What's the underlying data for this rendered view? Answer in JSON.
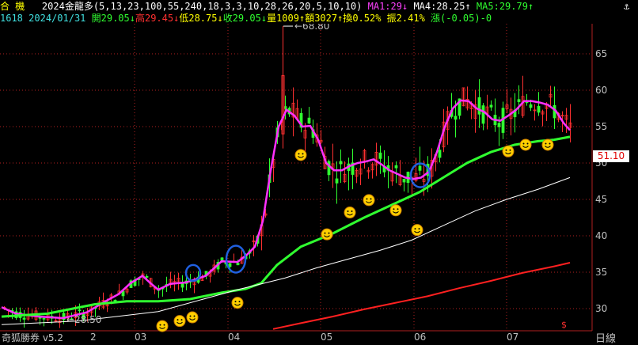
{
  "header": {
    "left1": "合  機",
    "indicator": "2024金龍多(5,13,23,100,55,240,18,3,3,10,28,26,20,5,10,10)",
    "ma1": "MA1:29↓",
    "ma4": "MA4:28.25↑",
    "ma5": "MA5:29.79↑",
    "code": "1618",
    "date": "2024/01/31",
    "open": "開29.05↓",
    "high": "高29.45↓",
    "low": "低28.75↓",
    "close": "收29.05↓",
    "volume": "量1009↑",
    "amount": "額3027↑",
    "turnover": "換0.52%",
    "amplitude": "振2.41%",
    "change": "漲(-0.05)-0"
  },
  "chart_data": {
    "type": "line",
    "y_ticks": [
      30,
      35,
      40,
      45,
      50,
      55,
      60,
      65
    ],
    "x_labels": [
      "03",
      "04",
      "05",
      "06",
      "07"
    ],
    "x_label_partial": "2",
    "last_price": "51.10",
    "max_label": "68.80",
    "min_label": "28.50",
    "period_label": "日線",
    "footer": "奇狐勝券 v5.2",
    "colors": {
      "ma_short": "#ff30ff",
      "ma_mid": "#30ff30",
      "ma_long": "#ffffff",
      "ma_longest": "#ff2020",
      "up": "#ff3030",
      "down": "#30ff30",
      "circle": "#2060e0"
    },
    "series": [
      {
        "key": "ma_short",
        "points": [
          [
            2,
            30.2
          ],
          [
            20,
            29.3
          ],
          [
            50,
            28.9
          ],
          [
            80,
            28.7
          ],
          [
            110,
            29.5
          ],
          [
            130,
            30.8
          ],
          [
            150,
            32
          ],
          [
            165,
            33.5
          ],
          [
            180,
            34.5
          ],
          [
            190,
            33.5
          ],
          [
            200,
            32.6
          ],
          [
            215,
            33.4
          ],
          [
            235,
            33.6
          ],
          [
            260,
            34.5
          ],
          [
            280,
            36.5
          ],
          [
            300,
            36.4
          ],
          [
            312,
            37.4
          ],
          [
            322,
            38.5
          ],
          [
            332,
            42
          ],
          [
            342,
            49
          ],
          [
            352,
            55
          ],
          [
            362,
            57.3
          ],
          [
            372,
            56.5
          ],
          [
            382,
            55
          ],
          [
            392,
            55.1
          ],
          [
            402,
            53.2
          ],
          [
            412,
            50
          ],
          [
            422,
            49
          ],
          [
            432,
            49
          ],
          [
            442,
            49.6
          ],
          [
            452,
            50
          ],
          [
            462,
            50.2
          ],
          [
            472,
            50.5
          ],
          [
            482,
            49.8
          ],
          [
            492,
            49
          ],
          [
            502,
            48.5
          ],
          [
            512,
            48
          ],
          [
            522,
            47.8
          ],
          [
            532,
            48
          ],
          [
            542,
            48.8
          ],
          [
            552,
            51.5
          ],
          [
            562,
            55
          ],
          [
            572,
            57.5
          ],
          [
            582,
            58.6
          ],
          [
            592,
            58.5
          ],
          [
            602,
            57.5
          ],
          [
            612,
            57
          ],
          [
            622,
            56
          ],
          [
            632,
            55.8
          ],
          [
            642,
            56.5
          ],
          [
            652,
            57.3
          ],
          [
            662,
            58.5
          ],
          [
            672,
            58.5
          ],
          [
            682,
            58.3
          ],
          [
            692,
            58
          ],
          [
            702,
            57.2
          ],
          [
            712,
            55.5
          ],
          [
            720,
            54.5
          ]
        ]
      },
      {
        "key": "ma_mid",
        "points": [
          [
            2,
            28.9
          ],
          [
            60,
            29.3
          ],
          [
            120,
            30.6
          ],
          [
            160,
            31
          ],
          [
            200,
            31
          ],
          [
            240,
            31.3
          ],
          [
            280,
            32.2
          ],
          [
            310,
            32.7
          ],
          [
            330,
            33.5
          ],
          [
            350,
            36
          ],
          [
            380,
            38.5
          ],
          [
            420,
            40.3
          ],
          [
            460,
            42.5
          ],
          [
            500,
            44.5
          ],
          [
            530,
            46
          ],
          [
            560,
            48
          ],
          [
            590,
            50
          ],
          [
            620,
            51.5
          ],
          [
            650,
            52.5
          ],
          [
            680,
            53
          ],
          [
            700,
            53.2
          ],
          [
            720,
            53.6
          ]
        ]
      },
      {
        "key": "ma_long",
        "points": [
          [
            2,
            27.8
          ],
          [
            100,
            28.3
          ],
          [
            200,
            29.6
          ],
          [
            300,
            32.6
          ],
          [
            360,
            34.2
          ],
          [
            400,
            35.6
          ],
          [
            440,
            36.8
          ],
          [
            480,
            38
          ],
          [
            520,
            39.4
          ],
          [
            560,
            41.4
          ],
          [
            600,
            43.4
          ],
          [
            640,
            45
          ],
          [
            680,
            46.4
          ],
          [
            720,
            48
          ]
        ]
      },
      {
        "key": "ma_longest",
        "points": [
          [
            345,
            27.2
          ],
          [
            380,
            28
          ],
          [
            420,
            28.9
          ],
          [
            460,
            29.9
          ],
          [
            500,
            30.8
          ],
          [
            540,
            31.7
          ],
          [
            580,
            32.8
          ],
          [
            620,
            33.8
          ],
          [
            660,
            34.9
          ],
          [
            700,
            35.8
          ],
          [
            720,
            36.3
          ]
        ]
      }
    ],
    "smileys": [
      [
        205,
        27.6
      ],
      [
        227,
        28.3
      ],
      [
        243,
        28.8
      ],
      [
        300,
        30.8
      ],
      [
        380,
        51.1
      ],
      [
        413,
        40.2
      ],
      [
        442,
        43.2
      ],
      [
        466,
        44.9
      ],
      [
        500,
        43.5
      ],
      [
        527,
        40.8
      ],
      [
        642,
        51.6
      ],
      [
        664,
        52.5
      ],
      [
        692,
        52.5
      ]
    ],
    "circles": [
      [
        244,
        34.9,
        9,
        10
      ],
      [
        298,
        36.8,
        12,
        17
      ],
      [
        531,
        48.3,
        12,
        15
      ]
    ]
  }
}
